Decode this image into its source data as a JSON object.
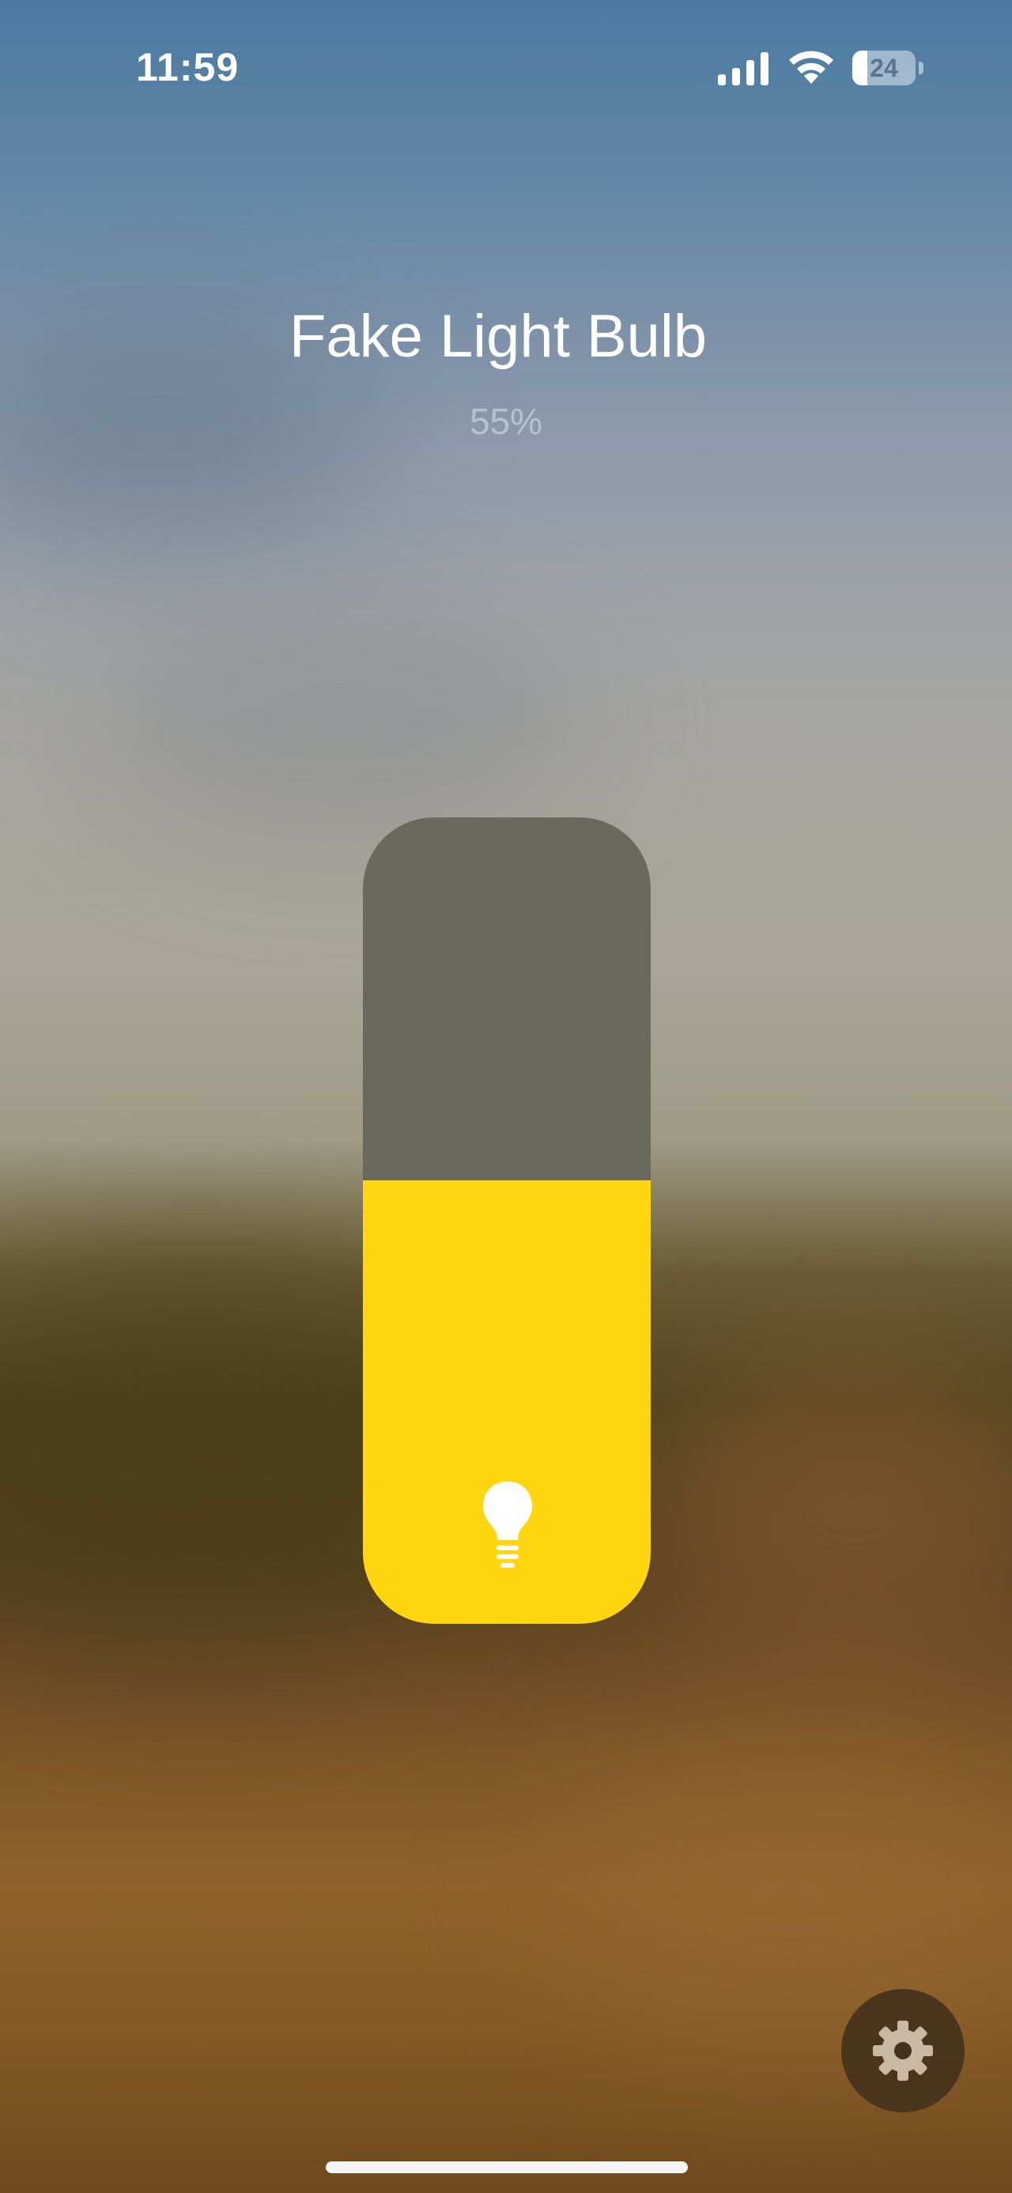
{
  "status_bar": {
    "time": "11:59",
    "battery_level": "24",
    "battery_fraction": 0.24,
    "icons": [
      "cellular-signal-icon",
      "wifi-icon",
      "battery-icon"
    ]
  },
  "device": {
    "name": "Fake Light Bulb",
    "brightness_label": "55%",
    "brightness": 0.55
  },
  "slider": {
    "track_color": "#6b695e",
    "fill_color": "#ffd60f",
    "icon": "lightbulb-icon"
  },
  "settings": {
    "icon": "gear-icon",
    "icon_color": "#c9b9a3"
  }
}
